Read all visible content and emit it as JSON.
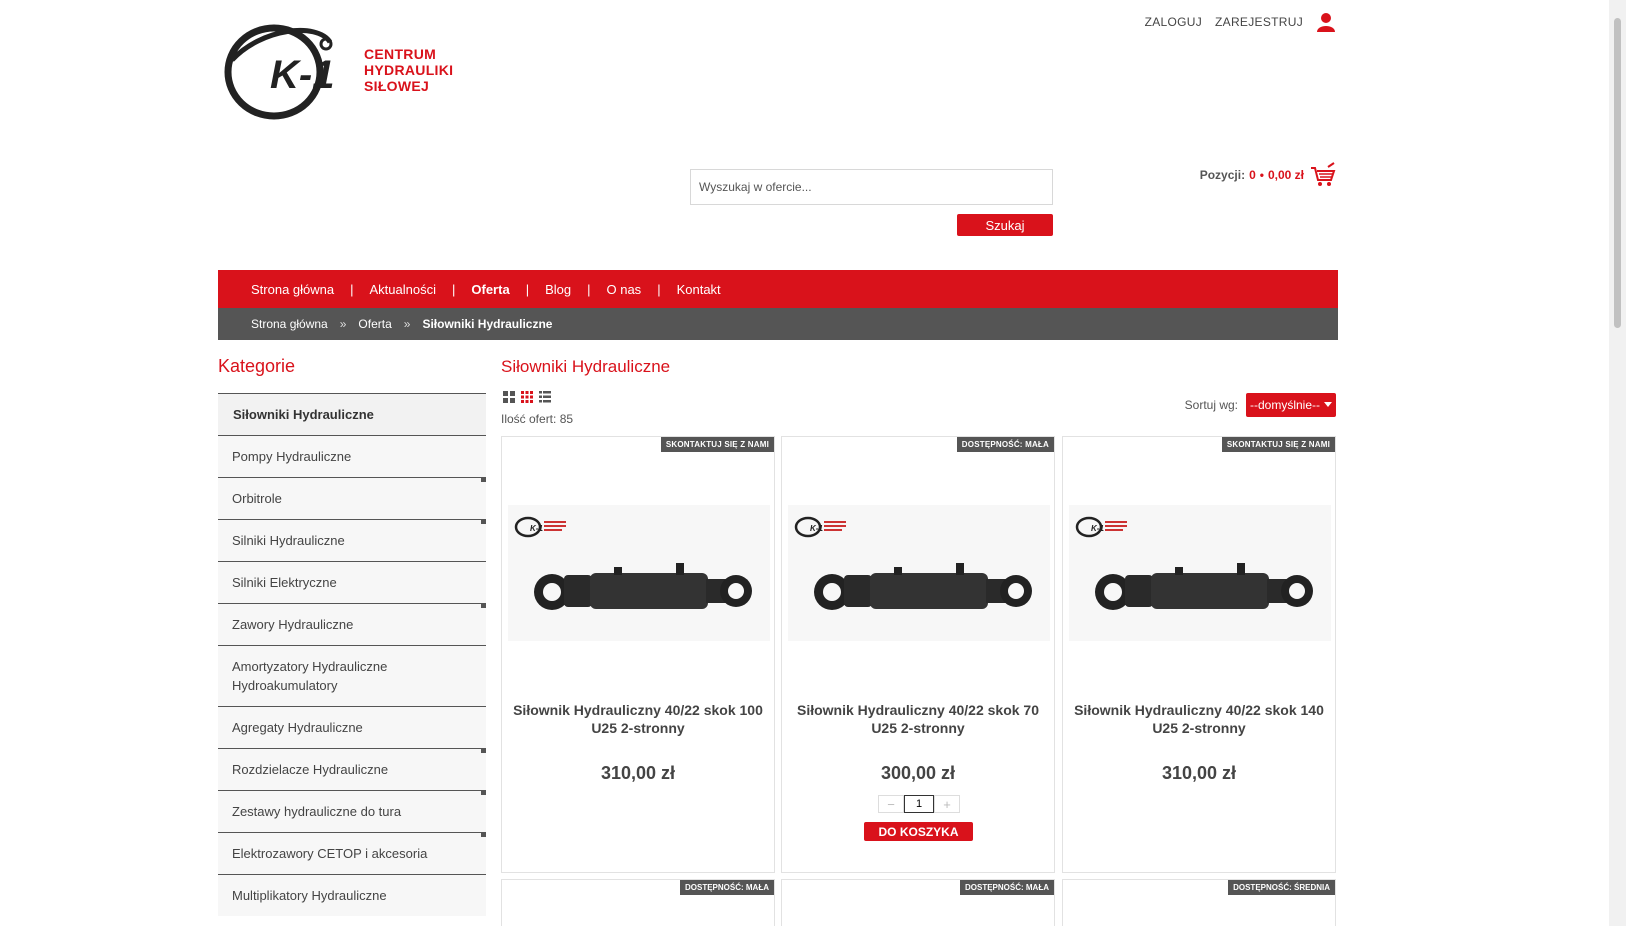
{
  "header": {
    "logo_text": [
      "CENTRUM",
      "HYDRAULIKI",
      "SIŁOWEJ"
    ],
    "login_label": "ZALOGUJ",
    "register_label": "ZAREJESTRUJ"
  },
  "search": {
    "placeholder": "Wyszukaj w ofercie...",
    "button_label": "Szukaj"
  },
  "cart": {
    "label": "Pozycji:",
    "count": "0",
    "dot": "•",
    "total": "0,00 zł"
  },
  "nav": {
    "items": [
      {
        "label": "Strona główna"
      },
      {
        "label": "Aktualności"
      },
      {
        "label": "Oferta"
      },
      {
        "label": "Blog"
      },
      {
        "label": "O nas"
      },
      {
        "label": "Kontakt"
      }
    ],
    "separator": "|"
  },
  "breadcrumb": {
    "items": [
      "Strona główna",
      "Oferta",
      "Siłowniki Hydrauliczne"
    ],
    "separator": "»"
  },
  "sidebar": {
    "title": "Kategorie",
    "items": [
      {
        "label": "Siłowniki Hydrauliczne"
      },
      {
        "label": "Pompy Hydrauliczne"
      },
      {
        "label": "Orbitrole"
      },
      {
        "label": "Silniki Hydrauliczne"
      },
      {
        "label": "Silniki Elektryczne"
      },
      {
        "label": "Zawory Hydrauliczne"
      },
      {
        "label": "Amortyzatory Hydrauliczne Hydroakumulatory"
      },
      {
        "label": "Agregaty Hydrauliczne"
      },
      {
        "label": "Rozdzielacze Hydrauliczne"
      },
      {
        "label": "Zestawy hydrauliczne do tura"
      },
      {
        "label": "Elektrozawory CETOP i akcesoria"
      },
      {
        "label": "Multiplikatory Hydrauliczne"
      }
    ]
  },
  "main": {
    "title": "Siłowniki Hydrauliczne",
    "offer_count": "Ilość ofert: 85",
    "sort_label": "Sortuj wg:",
    "sort_value": "--domyślnie--",
    "products": [
      {
        "badge": "SKONTAKTUJ SIĘ Z NAMI",
        "name": "Siłownik Hydrauliczny 40/22 skok 100 U25 2-stronny",
        "price": "310,00 zł"
      },
      {
        "badge": "DOSTĘPNOŚĆ: MAŁA",
        "name": "Siłownik Hydrauliczny 40/22 skok 70 U25 2-stronny",
        "price": "300,00 zł",
        "qty": "1",
        "minus": "−",
        "plus": "+",
        "add_label": "DO KOSZYKA"
      },
      {
        "badge": "SKONTAKTUJ SIĘ Z NAMI",
        "name": "Siłownik Hydrauliczny 40/22 skok 140 U25 2-stronny",
        "price": "310,00 zł"
      }
    ],
    "next_row_badges": [
      "DOSTĘPNOŚĆ: MAŁA",
      "DOSTĘPNOŚĆ: MAŁA",
      "DOSTĘPNOŚĆ: ŚREDNIA"
    ]
  },
  "colors": {
    "accent": "#d9121b",
    "breadcrumb_bg": "#555555",
    "sidebar_bg": "#f7f7f7"
  },
  "icons": {
    "user": "user-icon",
    "cart": "cart-icon",
    "grid_large": "grid-large-icon",
    "grid_small": "grid-small-icon",
    "list": "list-icon",
    "caret": "caret-down-icon"
  }
}
